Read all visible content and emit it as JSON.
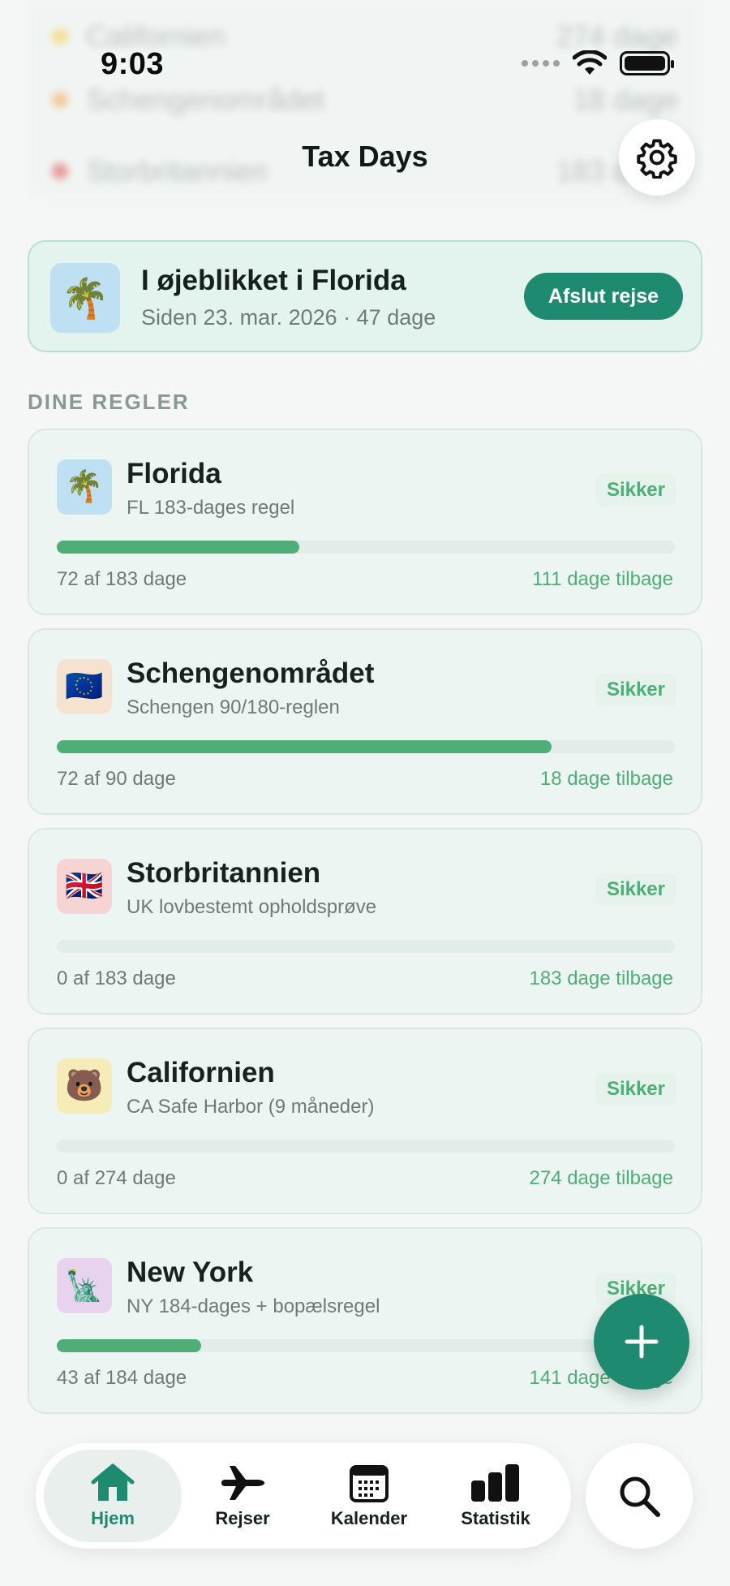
{
  "status_bar": {
    "time": "9:03"
  },
  "header": {
    "title": "Tax Days"
  },
  "ghost_rows": [
    {
      "label": "Californien",
      "value": "274 dage",
      "color": "#f2d03a"
    },
    {
      "label": "Schengenområdet",
      "value": "18 dage",
      "color": "#f0a24a"
    },
    {
      "label": "Storbritannien",
      "value": "183 dage",
      "color": "#e24a4a"
    }
  ],
  "current": {
    "icon": "🌴",
    "title": "I øjeblikket i Florida",
    "subtitle": "Siden 23. mar. 2026 · 47 dage",
    "end_trip_label": "Afslut rejse"
  },
  "section_label": "DINE REGLER",
  "rules": [
    {
      "icon": "🌴",
      "icon_bg": "#bfe0f3",
      "title": "Florida",
      "subtitle": "FL 183-dages regel",
      "status": "Sikker",
      "used": "72 af 183 dage",
      "remaining": "111 dage tilbage",
      "progress": 0.393
    },
    {
      "icon": "🇪🇺",
      "icon_bg": "#f6e3cf",
      "title": "Schengenområdet",
      "subtitle": "Schengen 90/180-reglen",
      "status": "Sikker",
      "used": "72 af 90 dage",
      "remaining": "18 dage tilbage",
      "progress": 0.8
    },
    {
      "icon": "🇬🇧",
      "icon_bg": "#f6d4d4",
      "title": "Storbritannien",
      "subtitle": "UK lovbestemt opholdsprøve",
      "status": "Sikker",
      "used": "0 af 183 dage",
      "remaining": "183 dage tilbage",
      "progress": 0
    },
    {
      "icon": "🐻",
      "icon_bg": "#f5ecb8",
      "title": "Californien",
      "subtitle": "CA Safe Harbor (9 måneder)",
      "status": "Sikker",
      "used": "0 af 274 dage",
      "remaining": "274 dage tilbage",
      "progress": 0
    },
    {
      "icon": "🗽",
      "icon_bg": "#e7d3ee",
      "title": "New York",
      "subtitle": "NY 184-dages + bopælsregel",
      "status": "Sikker",
      "used": "43 af 184 dage",
      "remaining": "141 dage tilbage",
      "progress": 0.234
    }
  ],
  "tabs": [
    {
      "label": "Hjem",
      "icon": "home-icon",
      "active": true
    },
    {
      "label": "Rejser",
      "icon": "airplane-icon",
      "active": false
    },
    {
      "label": "Kalender",
      "icon": "calendar-icon",
      "active": false
    },
    {
      "label": "Statistik",
      "icon": "bar-chart-icon",
      "active": false
    }
  ],
  "colors": {
    "accent": "#1e8a70",
    "safe": "#4fae78"
  }
}
